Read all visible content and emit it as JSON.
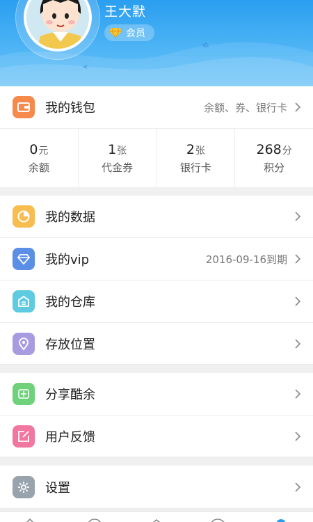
{
  "profile": {
    "username": "王大默",
    "member_label": "会员"
  },
  "wallet": {
    "label": "我的钱包",
    "detail": "余额、券、银行卡"
  },
  "stats": [
    {
      "value": "0",
      "unit": "元",
      "name": "余额"
    },
    {
      "value": "1",
      "unit": "张",
      "name": "代金券"
    },
    {
      "value": "2",
      "unit": "张",
      "name": "银行卡"
    },
    {
      "value": "268",
      "unit": "分",
      "name": "积分"
    }
  ],
  "menu": {
    "data": {
      "label": "我的数据"
    },
    "vip": {
      "label": "我的vip",
      "detail": "2016-09-16到期"
    },
    "warehouse": {
      "label": "我的仓库"
    },
    "storage": {
      "label": "存放位置"
    },
    "share": {
      "label": "分享酷余"
    },
    "feedback": {
      "label": "用户反馈"
    },
    "settings": {
      "label": "设置"
    }
  },
  "colors": {
    "header": "#2a9ef0",
    "wallet_icon": "#f6894b",
    "data_icon": "#f7bd4f",
    "vip_icon": "#5b8fe6",
    "warehouse_icon": "#5fcbe0",
    "storage_icon": "#a99be0",
    "share_icon": "#6fd27a",
    "feedback_icon": "#f277a0",
    "settings_icon": "#98a3ae",
    "active_tab": "#2a9ef0"
  },
  "icons": {
    "wallet": "wallet-icon",
    "data": "pie-chart-icon",
    "vip": "diamond-icon",
    "warehouse": "warehouse-icon",
    "storage": "location-pin-icon",
    "share": "share-logo-icon",
    "feedback": "edit-icon",
    "settings": "gear-icon"
  }
}
